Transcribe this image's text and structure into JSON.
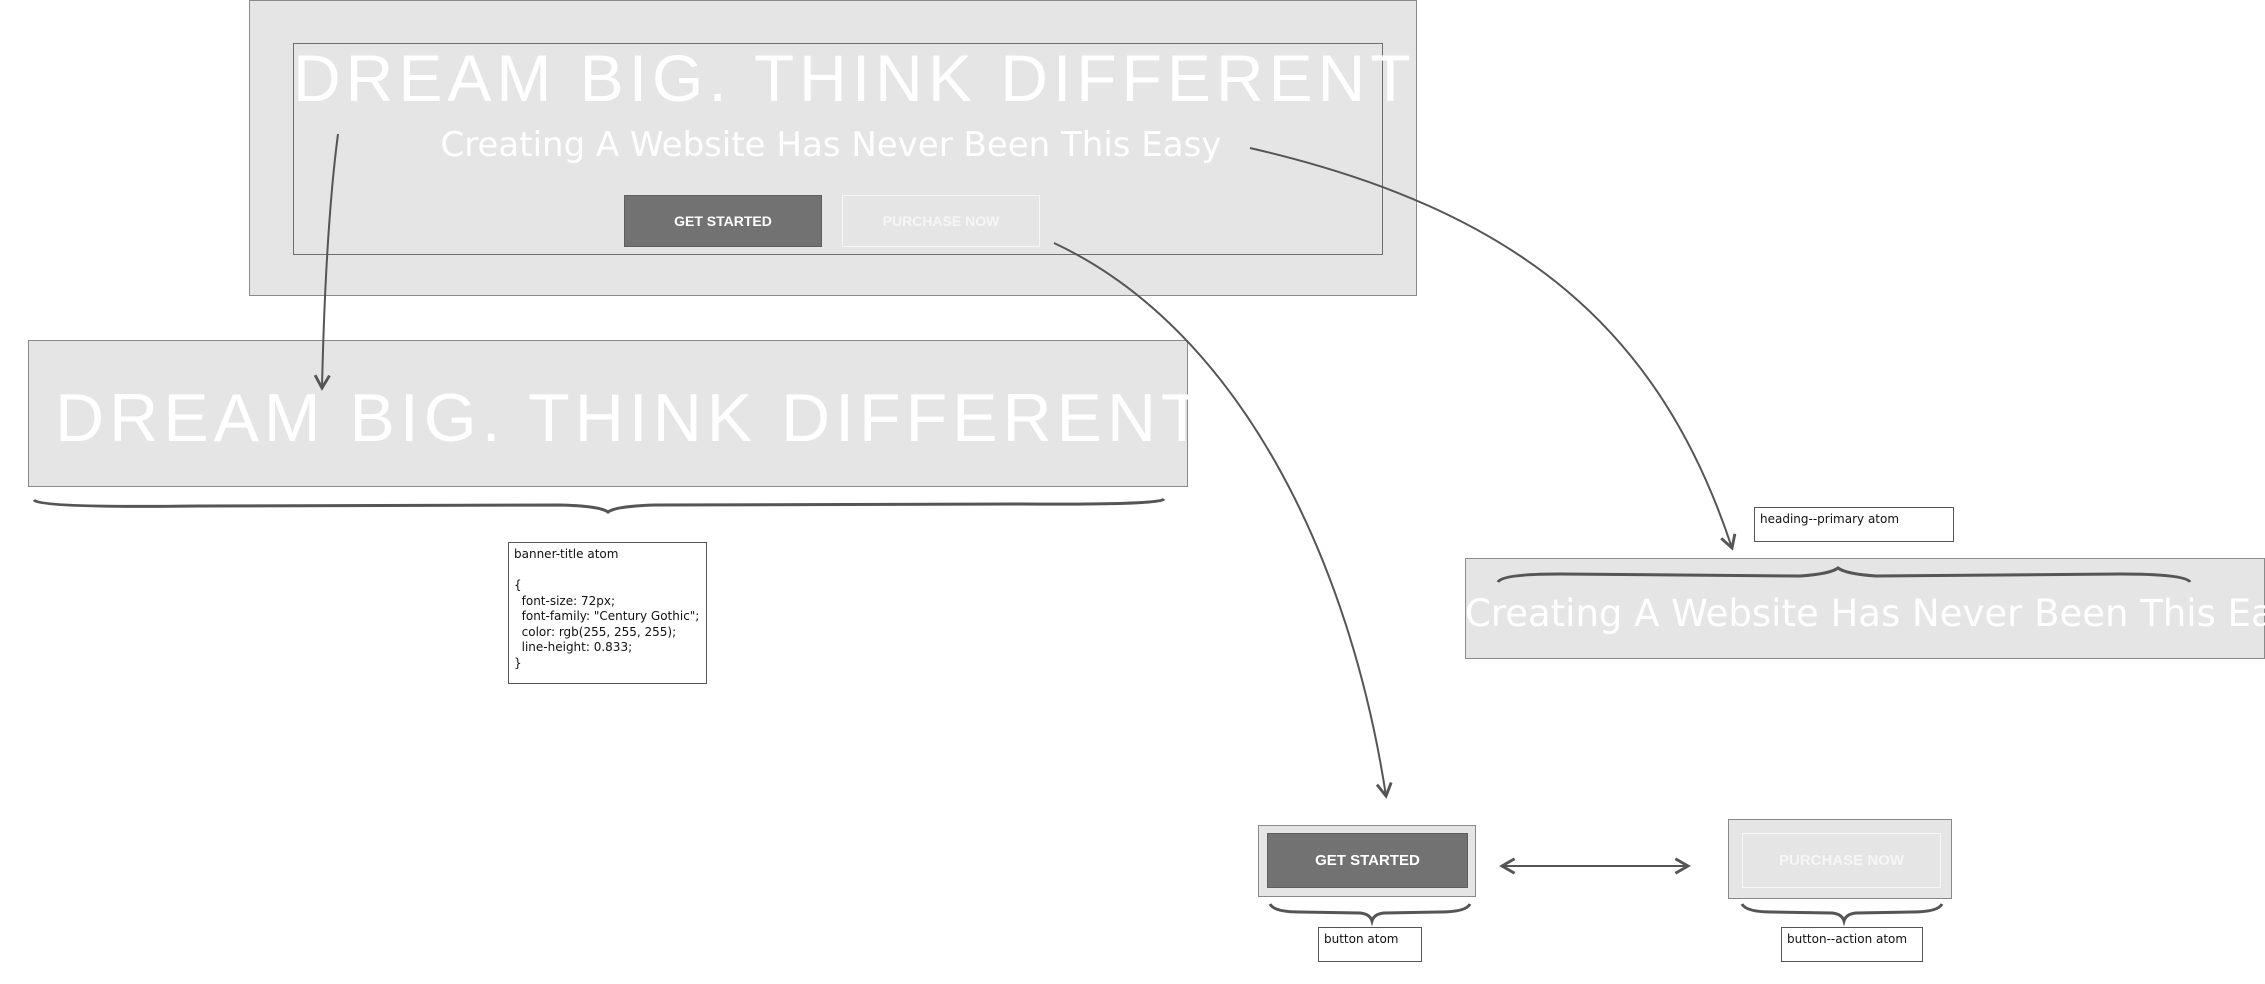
{
  "hero": {
    "title": "DREAM BIG. THINK DIFFERENT",
    "subtitle": "Creating A Website Has Never Been This Easy",
    "primary_button": "GET STARTED",
    "secondary_button": "PURCHASE NOW"
  },
  "banner_title_atom": {
    "text": "DREAM BIG. THINK DIFFERENT",
    "note": "banner-title atom\n\n{\n  font-size: 72px;\n  font-family: \"Century Gothic\";\n  color: rgb(255, 255, 255);\n  line-height: 0.833;\n}"
  },
  "heading_primary_atom": {
    "text": "Creating A Website Has Never Been This Easy",
    "note": "heading--primary atom"
  },
  "button_atom": {
    "label": "GET STARTED",
    "note": "button atom"
  },
  "button_action_atom": {
    "label": "PURCHASE NOW",
    "note": "button--action atom"
  },
  "colors": {
    "panel": "#e5e5e5",
    "button_dark": "#727272",
    "text_white": "#ffffff",
    "connector": "#555555"
  }
}
